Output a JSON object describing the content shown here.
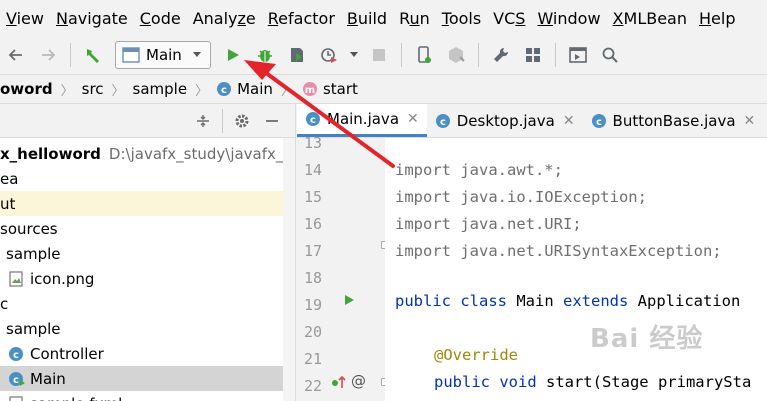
{
  "menu": [
    {
      "first": "",
      "rest": "View",
      "mn": "V"
    },
    {
      "first": "",
      "rest": "avigate",
      "mn": "N"
    },
    {
      "first": "",
      "rest": "ode",
      "mn": "C"
    },
    {
      "first": "Analy",
      "rest": "e",
      "mn": "z"
    },
    {
      "first": "",
      "rest": "efactor",
      "mn": "R"
    },
    {
      "first": "",
      "rest": "uild",
      "mn": "B"
    },
    {
      "first": "R",
      "rest": "n",
      "mn": "u"
    },
    {
      "first": "",
      "rest": "ools",
      "mn": "T"
    },
    {
      "first": "VC",
      "rest": "",
      "mn": "S"
    },
    {
      "first": "",
      "rest": "indow",
      "mn": "W"
    },
    {
      "first": "",
      "rest": "MLBean",
      "mn": "X"
    },
    {
      "first": "",
      "rest": "elp",
      "mn": "H"
    }
  ],
  "toolbar": {
    "run_config": "Main"
  },
  "breadcrumb": {
    "project": "oword",
    "src": "src",
    "pkg": "sample",
    "cls": "Main",
    "method": "start"
  },
  "project_tree": {
    "rows": [
      {
        "label": "x_helloword",
        "path": "D:\\javafx_study\\javafx_he",
        "bold": true,
        "indent": 0,
        "icon": "none",
        "state": "normal"
      },
      {
        "label": "ea",
        "indent": 0,
        "icon": "none",
        "state": "normal"
      },
      {
        "label": "ut",
        "indent": 0,
        "icon": "none",
        "state": "highlight"
      },
      {
        "label": "sources",
        "indent": 0,
        "icon": "none",
        "state": "normal"
      },
      {
        "label": "sample",
        "indent": 6,
        "icon": "none",
        "state": "normal"
      },
      {
        "label": "icon.png",
        "indent": 8,
        "icon": "image",
        "state": "normal"
      },
      {
        "label": "c",
        "indent": 0,
        "icon": "none",
        "state": "normal"
      },
      {
        "label": "sample",
        "indent": 6,
        "icon": "none",
        "state": "normal"
      },
      {
        "label": "Controller",
        "indent": 8,
        "icon": "class",
        "state": "normal"
      },
      {
        "label": "Main",
        "indent": 8,
        "icon": "class-run",
        "state": "selected"
      },
      {
        "label": "sample.fxml",
        "indent": 8,
        "icon": "fxml",
        "state": "normal"
      }
    ]
  },
  "tabs": [
    {
      "label": "Main.java",
      "active": true
    },
    {
      "label": "Desktop.java",
      "active": false
    },
    {
      "label": "ButtonBase.java",
      "active": false
    }
  ],
  "code": {
    "line_numbers": [
      "13",
      "14",
      "15",
      "16",
      "17",
      "18",
      "19",
      "20",
      "21",
      "22"
    ],
    "lines": [
      "",
      "import java.awt.*;",
      "import java.io.IOException;",
      "import java.net.URI;",
      "import java.net.URISyntaxException;",
      "",
      "",
      "",
      "",
      ""
    ],
    "l19_kw1": "public class ",
    "l19_name": "Main ",
    "l19_kw2": "extends ",
    "l19_rest": "Application",
    "l21_ann": "@Override",
    "l22_kw": "public void ",
    "l22_rest": "start(Stage primarySta"
  },
  "watermark": "Bai 经验",
  "colors": {
    "keyword": "#0033b3",
    "annotation": "#9e880d",
    "run_green": "#3fa637",
    "arrow_red": "#e3242b",
    "tab_accent": "#4083c9"
  }
}
